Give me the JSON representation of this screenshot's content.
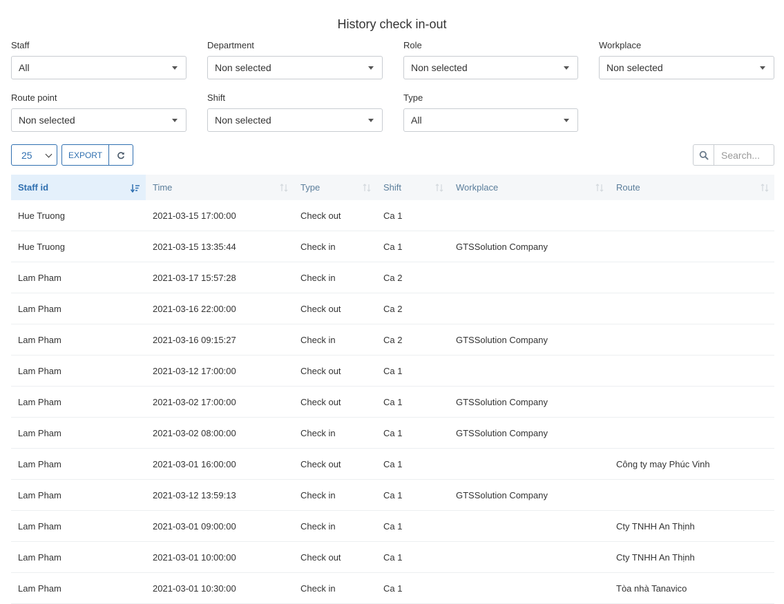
{
  "page": {
    "title": "History check in-out"
  },
  "filters": [
    {
      "label": "Staff",
      "value": "All"
    },
    {
      "label": "Department",
      "value": "Non selected"
    },
    {
      "label": "Role",
      "value": "Non selected"
    },
    {
      "label": "Workplace",
      "value": "Non selected"
    },
    {
      "label": "Route point",
      "value": "Non selected"
    },
    {
      "label": "Shift",
      "value": "Non selected"
    },
    {
      "label": "Type",
      "value": "All"
    }
  ],
  "toolbar": {
    "page_size": "25",
    "export_label": "EXPORT",
    "refresh_icon": "refresh-icon",
    "search_icon": "search-icon",
    "search_placeholder": "Search..."
  },
  "colors": {
    "accent": "#2f6fb0",
    "header_bg": "#f5f7f9",
    "active_header_bg": "#e4f0fb"
  },
  "table": {
    "columns": [
      "Staff id",
      "Time",
      "Type",
      "Shift",
      "Workplace",
      "Route"
    ],
    "sorted_column": "Staff id",
    "rows": [
      [
        "Hue Truong",
        "2021-03-15 17:00:00",
        "Check out",
        "Ca 1",
        "",
        ""
      ],
      [
        "Hue Truong",
        "2021-03-15 13:35:44",
        "Check in",
        "Ca 1",
        "GTSSolution Company",
        ""
      ],
      [
        "Lam Pham",
        "2021-03-17 15:57:28",
        "Check in",
        "Ca 2",
        "",
        ""
      ],
      [
        "Lam Pham",
        "2021-03-16 22:00:00",
        "Check out",
        "Ca 2",
        "",
        ""
      ],
      [
        "Lam Pham",
        "2021-03-16 09:15:27",
        "Check in",
        "Ca 2",
        "GTSSolution Company",
        ""
      ],
      [
        "Lam Pham",
        "2021-03-12 17:00:00",
        "Check out",
        "Ca 1",
        "",
        ""
      ],
      [
        "Lam Pham",
        "2021-03-02 17:00:00",
        "Check out",
        "Ca 1",
        "GTSSolution Company",
        ""
      ],
      [
        "Lam Pham",
        "2021-03-02 08:00:00",
        "Check in",
        "Ca 1",
        "GTSSolution Company",
        ""
      ],
      [
        "Lam Pham",
        "2021-03-01 16:00:00",
        "Check out",
        "Ca 1",
        "",
        "Công ty may Phúc Vinh"
      ],
      [
        "Lam Pham",
        "2021-03-12 13:59:13",
        "Check in",
        "Ca 1",
        "GTSSolution Company",
        ""
      ],
      [
        "Lam Pham",
        "2021-03-01 09:00:00",
        "Check in",
        "Ca 1",
        "",
        "Cty TNHH An Thịnh"
      ],
      [
        "Lam Pham",
        "2021-03-01 10:00:00",
        "Check out",
        "Ca 1",
        "",
        "Cty TNHH An Thịnh"
      ],
      [
        "Lam Pham",
        "2021-03-01 10:30:00",
        "Check in",
        "Ca 1",
        "",
        "Tòa nhà Tanavico"
      ]
    ]
  }
}
